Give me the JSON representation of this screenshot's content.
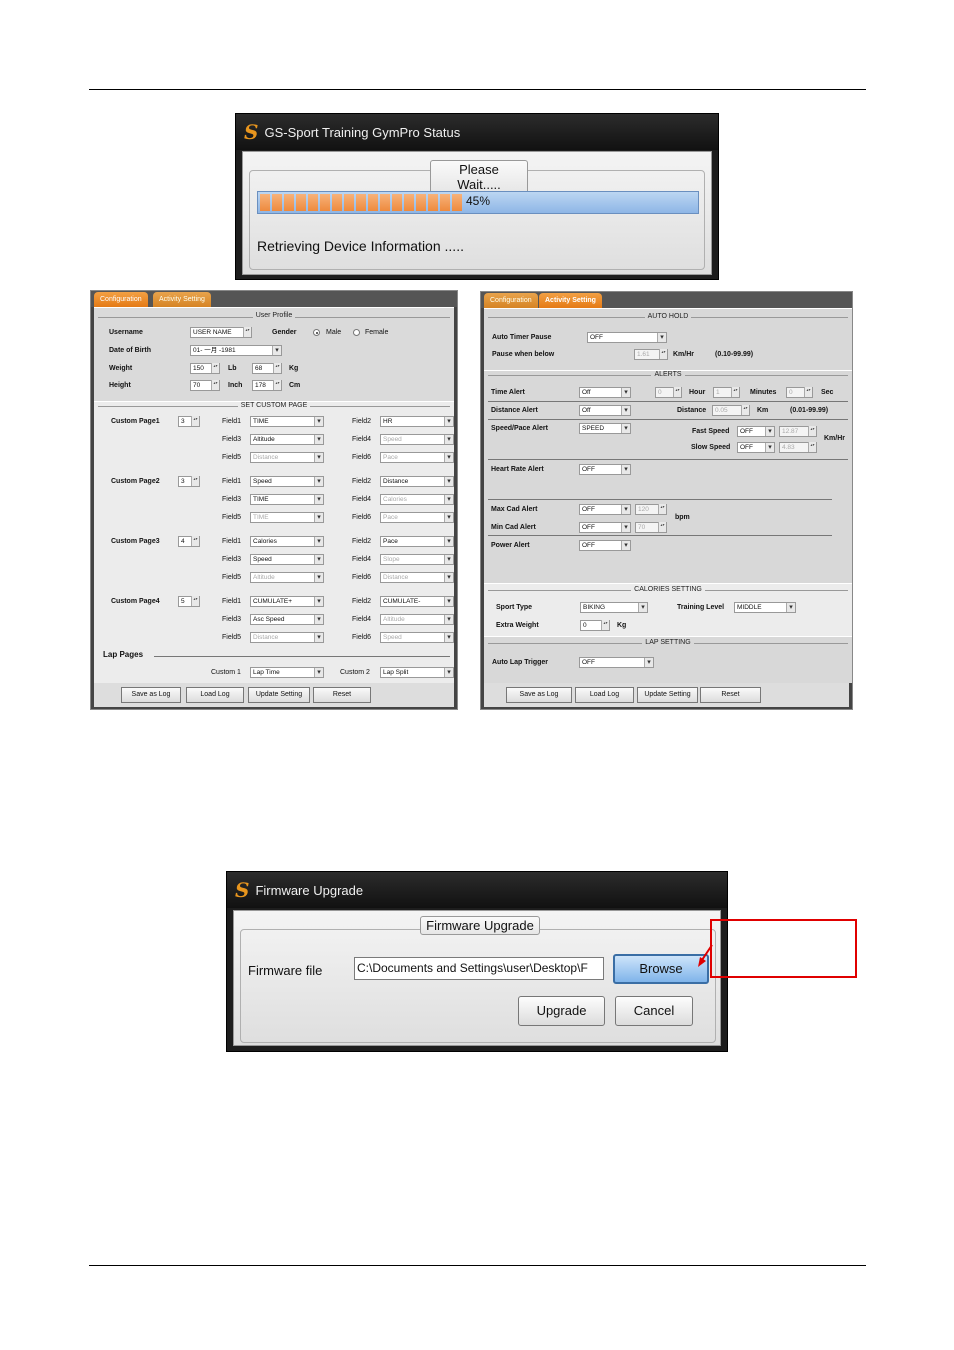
{
  "status_window": {
    "title": "GS-Sport Training GymPro Status",
    "group_label": "Please Wait.....",
    "progress": 0.45,
    "progress_label": "45%",
    "message": "Retrieving Device Information .....",
    "accent": "#e9961e"
  },
  "config_panel": {
    "tabs": [
      "Configuration",
      "Activity Setting"
    ],
    "user_profile": {
      "header": "User Profile",
      "username_label": "Username",
      "username_value": "USER NAME",
      "gender_label": "Gender",
      "gender_options": [
        "Male",
        "Female"
      ],
      "gender_selected": "Male",
      "dob_label": "Date of Birth",
      "dob_value": "01- 一月 -1981",
      "weight_label": "Weight",
      "weight_lb": "150",
      "weight_lb_unit": "Lb",
      "weight_kg": "68",
      "weight_kg_unit": "Kg",
      "height_label": "Height",
      "height_in": "70",
      "height_in_unit": "Inch",
      "height_cm": "178",
      "height_cm_unit": "Cm"
    },
    "custom_page_header": "SET CUSTOM PAGE",
    "custom_pages": [
      {
        "label": "Custom Page1",
        "count": "3",
        "fields": [
          [
            "Field1",
            "TIME"
          ],
          [
            "Field2",
            "HR"
          ],
          [
            "Field3",
            "Altitude"
          ],
          [
            "Field4",
            "Speed"
          ],
          [
            "Field5",
            "Distance"
          ],
          [
            "Field6",
            "Pace"
          ]
        ]
      },
      {
        "label": "Custom Page2",
        "count": "3",
        "fields": [
          [
            "Field1",
            "Speed"
          ],
          [
            "Field2",
            "Distance"
          ],
          [
            "Field3",
            "TIME"
          ],
          [
            "Field4",
            "Calories"
          ],
          [
            "Field5",
            "TIME"
          ],
          [
            "Field6",
            "Pace"
          ]
        ]
      },
      {
        "label": "Custom Page3",
        "count": "4",
        "fields": [
          [
            "Field1",
            "Calories"
          ],
          [
            "Field2",
            "Pace"
          ],
          [
            "Field3",
            "Speed"
          ],
          [
            "Field4",
            "Slope"
          ],
          [
            "Field5",
            "Altitude"
          ],
          [
            "Field6",
            "Distance"
          ]
        ]
      },
      {
        "label": "Custom Page4",
        "count": "5",
        "fields": [
          [
            "Field1",
            "CUMULATE+"
          ],
          [
            "Field2",
            "CUMULATE-"
          ],
          [
            "Field3",
            "Asc Speed"
          ],
          [
            "Field4",
            "Altitude"
          ],
          [
            "Field5",
            "Distance"
          ],
          [
            "Field6",
            "Speed"
          ]
        ]
      }
    ],
    "lap_pages": {
      "header": "Lap Pages",
      "custom1_label": "Custom 1",
      "custom1_value": "Lap Time",
      "custom2_label": "Custom 2",
      "custom2_value": "Lap Split"
    },
    "buttons": [
      "Save as Log",
      "Load Log",
      "Update Setting",
      "Reset"
    ]
  },
  "activity_panel": {
    "tabs": [
      "Configuration",
      "Activity Setting"
    ],
    "auto_hold": {
      "header": "AUTO HOLD",
      "timer_pause_label": "Auto Timer Pause",
      "timer_pause_value": "OFF",
      "pause_below_label": "Pause when below",
      "pause_below_value": "1.61",
      "pause_below_unit": "Km/Hr",
      "pause_below_range": "(0.10-99.99)"
    },
    "alerts": {
      "header": "ALERTS",
      "time_label": "Time Alert",
      "time_value": "Off",
      "hour_value": "0",
      "hour_label": "Hour",
      "min_value": "1",
      "min_label": "Minutes",
      "sec_value": "0",
      "sec_label": "Sec",
      "distance_label": "Distance Alert",
      "distance_value": "Off",
      "distance_sub_label": "Distance",
      "distance_num": "0.05",
      "distance_unit": "Km",
      "distance_range": "(0.01-99.99)",
      "speed_label": "Speed/Pace Alert",
      "speed_value": "SPEED",
      "fast_label": "Fast Speed",
      "fast_value": "OFF",
      "fast_num": "12.87",
      "slow_label": "Slow Speed",
      "slow_value": "OFF",
      "slow_num": "4.83",
      "speed_unit": "Km/Hr",
      "hr_label": "Heart Rate Alert",
      "hr_value": "OFF",
      "max_cad_label": "Max Cad Alert",
      "max_cad_value": "OFF",
      "max_cad_num": "120",
      "min_cad_label": "Min Cad Alert",
      "min_cad_value": "OFF",
      "min_cad_num": "70",
      "cad_unit": "bpm",
      "power_label": "Power Alert",
      "power_value": "OFF"
    },
    "calories": {
      "header": "CALORIES SETTING",
      "sport_label": "Sport Type",
      "sport_value": "BIKING",
      "level_label": "Training Level",
      "level_value": "MIDDLE",
      "weight_label": "Extra Weight",
      "weight_value": "0",
      "weight_unit": "Kg"
    },
    "lap": {
      "header": "LAP SETTING",
      "trigger_label": "Auto Lap Trigger",
      "trigger_value": "OFF"
    },
    "buttons": [
      "Save as Log",
      "Load Log",
      "Update Setting",
      "Reset"
    ]
  },
  "firmware_window": {
    "title": "Firmware Upgrade",
    "group_label": "Firmware Upgrade",
    "file_label": "Firmware file",
    "file_value": "C:\\Documents and Settings\\user\\Desktop\\F",
    "browse_label": "Browse",
    "upgrade_label": "Upgrade",
    "cancel_label": "Cancel",
    "callout_color": "#e00000"
  }
}
